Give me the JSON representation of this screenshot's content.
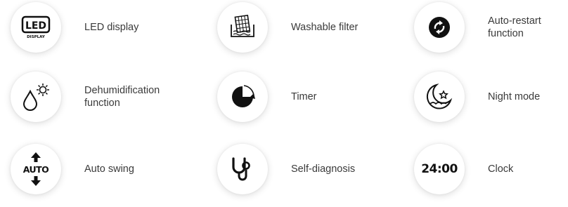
{
  "features": [
    {
      "id": "led",
      "icon": "led-display-icon",
      "label": "LED display",
      "icon_text": "LED",
      "icon_subtext": "DISPLAY"
    },
    {
      "id": "filter",
      "icon": "washable-filter-icon",
      "label": "Washable filter"
    },
    {
      "id": "restart",
      "icon": "auto-restart-icon",
      "label": "Auto-restart\nfunction"
    },
    {
      "id": "dehumid",
      "icon": "dehumidification-icon",
      "label": "Dehumidification\nfunction"
    },
    {
      "id": "timer",
      "icon": "timer-icon",
      "label": "Timer"
    },
    {
      "id": "night",
      "icon": "night-mode-icon",
      "label": "Night mode"
    },
    {
      "id": "swing",
      "icon": "auto-swing-icon",
      "label": "Auto swing",
      "icon_text": "AUTO"
    },
    {
      "id": "diag",
      "icon": "self-diagnosis-icon",
      "label": "Self-diagnosis"
    },
    {
      "id": "clock",
      "icon": "clock-icon",
      "label": "Clock",
      "icon_text": "24:00"
    }
  ],
  "colors": {
    "icon": "#111111",
    "text": "#3a3a3a",
    "background": "#ffffff"
  }
}
